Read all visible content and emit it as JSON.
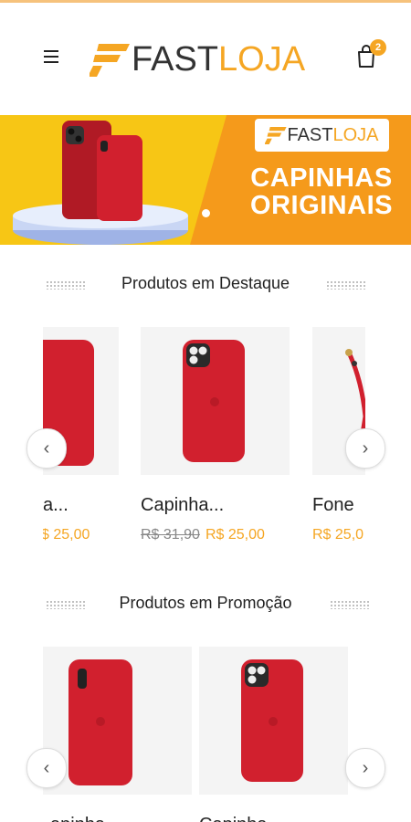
{
  "header": {
    "logo_part1": "FAST",
    "logo_part2": "LOJA",
    "cart_count": "2"
  },
  "banner": {
    "logo_part1": "FAST",
    "logo_part2": "LOJA",
    "title_line1": "CAPINHAS",
    "title_line2": "ORIGINAIS"
  },
  "featured": {
    "title": "Produtos em Destaque",
    "products": [
      {
        "name": "a...",
        "price_new": "$ 25,00"
      },
      {
        "name": "Capinha...",
        "price_old": "R$ 31,90",
        "price_new": "R$ 25,00"
      },
      {
        "name": "Fone",
        "price_new": "R$ 25,0"
      }
    ]
  },
  "promo": {
    "title": "Produtos em Promoção",
    "products": [
      {
        "name": "apinha"
      },
      {
        "name": "Capinha"
      }
    ]
  },
  "colors": {
    "accent": "#f5a623",
    "case_red": "#d1202e",
    "banner_yellow": "#f7c615",
    "banner_orange": "#f59a1b"
  },
  "icons": {
    "menu": "hamburger-icon",
    "cart": "shopping-bag-icon",
    "prev": "chevron-left-icon",
    "next": "chevron-right-icon"
  }
}
